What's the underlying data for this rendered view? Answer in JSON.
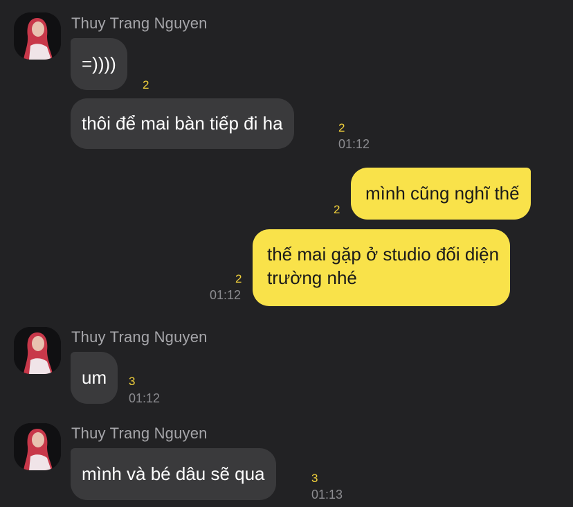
{
  "messages": [
    {
      "sender": "Thuy Trang Nguyen",
      "text": "=))))",
      "unread": "2"
    },
    {
      "text": "thôi để mai bàn tiếp đi ha",
      "unread": "2",
      "time": "01:12"
    },
    {
      "text": "mình cũng nghĩ thế",
      "unread": "2"
    },
    {
      "text_line1": "thế mai gặp ở studio đối diện",
      "text_line2": "trường nhé",
      "unread": "2",
      "time": "01:12"
    },
    {
      "sender": "Thuy Trang Nguyen",
      "text": "um",
      "unread": "3",
      "time": "01:12"
    },
    {
      "sender": "Thuy Trang Nguyen",
      "text": "mình và bé dâu sẽ qua",
      "unread": "3",
      "time": "01:13"
    }
  ],
  "colors": {
    "background": "#222224",
    "incoming_bubble": "#3a3a3c",
    "outgoing_bubble": "#f9e24a",
    "unread_count": "#f2d13b"
  },
  "icons": {
    "avatar": "profile-photo-avatar"
  }
}
